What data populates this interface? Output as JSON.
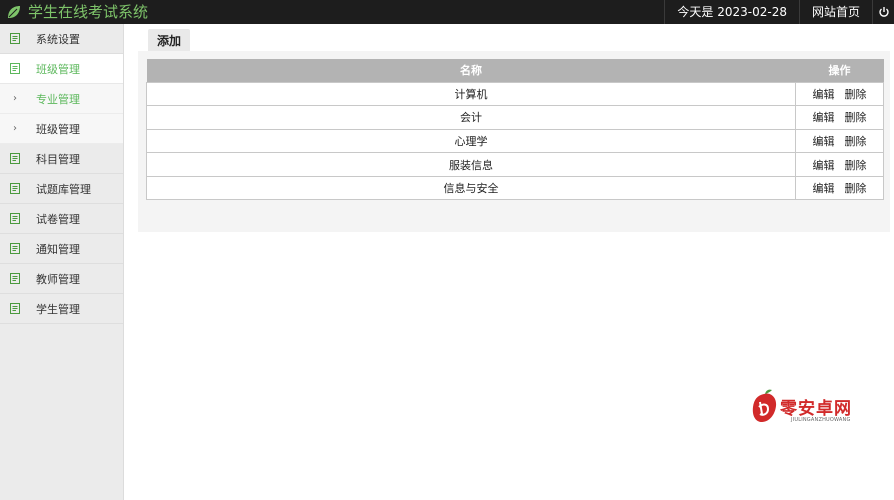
{
  "app": {
    "title": "学生在线考试系统"
  },
  "header": {
    "date_text": "今天是 2023-02-28",
    "home_link": "网站首页"
  },
  "sidebar": {
    "items": [
      {
        "label": "系统设置",
        "icon": "document-icon",
        "state": "normal"
      },
      {
        "label": "班级管理",
        "icon": "document-icon",
        "state": "active"
      },
      {
        "label": "专业管理",
        "icon": "chevron-right-icon",
        "state": "sub-active"
      },
      {
        "label": "班级管理",
        "icon": "chevron-right-icon",
        "state": "sub"
      },
      {
        "label": "科目管理",
        "icon": "document-icon",
        "state": "normal"
      },
      {
        "label": "试题库管理",
        "icon": "document-icon",
        "state": "normal"
      },
      {
        "label": "试卷管理",
        "icon": "document-icon",
        "state": "normal"
      },
      {
        "label": "通知管理",
        "icon": "document-icon",
        "state": "normal"
      },
      {
        "label": "教师管理",
        "icon": "document-icon",
        "state": "normal"
      },
      {
        "label": "学生管理",
        "icon": "document-icon",
        "state": "normal"
      }
    ]
  },
  "main": {
    "add_tab": "添加",
    "table": {
      "headers": {
        "name": "名称",
        "ops": "操作"
      },
      "rows": [
        {
          "name": "计算机",
          "edit": "编辑",
          "delete": "删除"
        },
        {
          "name": "会计",
          "edit": "编辑",
          "delete": "删除"
        },
        {
          "name": "心理学",
          "edit": "编辑",
          "delete": "删除"
        },
        {
          "name": "服装信息",
          "edit": "编辑",
          "delete": "删除"
        },
        {
          "name": "信息与安全",
          "edit": "编辑",
          "delete": "删除"
        }
      ]
    }
  },
  "watermark": {
    "text": "零安卓网",
    "sub": "JIULINGANZHUOWANG"
  },
  "colors": {
    "accent": "#5cb85c",
    "topbar": "#1d1d1d",
    "header_row": "#b3b3b3"
  }
}
